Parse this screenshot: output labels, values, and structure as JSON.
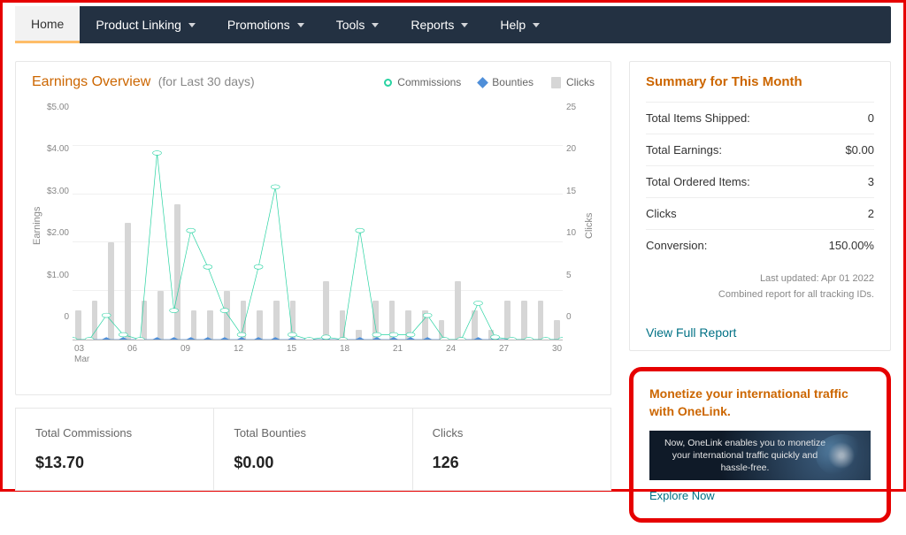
{
  "nav": {
    "items": [
      {
        "label": "Home",
        "active": true,
        "dropdown": false
      },
      {
        "label": "Product Linking",
        "active": false,
        "dropdown": true
      },
      {
        "label": "Promotions",
        "active": false,
        "dropdown": true
      },
      {
        "label": "Tools",
        "active": false,
        "dropdown": true
      },
      {
        "label": "Reports",
        "active": false,
        "dropdown": true
      },
      {
        "label": "Help",
        "active": false,
        "dropdown": true
      }
    ]
  },
  "chart": {
    "title": "Earnings Overview",
    "subtitle": "(for Last 30 days)",
    "legend": {
      "commissions": "Commissions",
      "bounties": "Bounties",
      "clicks": "Clicks"
    },
    "y_left_label": "Earnings",
    "y_right_label": "Clicks",
    "y_left_ticks": [
      "$5.00",
      "$4.00",
      "$3.00",
      "$2.00",
      "$1.00",
      "0"
    ],
    "y_right_ticks": [
      "25",
      "20",
      "15",
      "10",
      "5",
      "0"
    ],
    "x_ticks": [
      "03",
      "06",
      "09",
      "12",
      "15",
      "18",
      "21",
      "24",
      "27",
      "30"
    ],
    "x_month": "Mar"
  },
  "chart_data": {
    "type": "line+bar",
    "x": [
      "03",
      "04",
      "05",
      "06",
      "07",
      "08",
      "09",
      "10",
      "11",
      "12",
      "13",
      "14",
      "15",
      "16",
      "17",
      "18",
      "19",
      "20",
      "21",
      "22",
      "23",
      "24",
      "25",
      "26",
      "27",
      "28",
      "29",
      "30",
      "31",
      "01"
    ],
    "series": [
      {
        "name": "Commissions",
        "axis": "left",
        "style": "line",
        "color": "#29d3a2",
        "values": [
          0,
          0,
          0.5,
          0.1,
          0,
          3.85,
          0.6,
          2.25,
          1.5,
          0.6,
          0.1,
          1.5,
          3.15,
          0.1,
          0,
          0.05,
          0,
          2.25,
          0.1,
          0.1,
          0.1,
          0.5,
          0,
          0,
          0.75,
          0.05,
          0,
          0,
          0,
          0
        ]
      },
      {
        "name": "Bounties",
        "axis": "left",
        "style": "line",
        "color": "#4f8fd9",
        "values": [
          0,
          0,
          0,
          0,
          0,
          0,
          0,
          0,
          0,
          0,
          0,
          0,
          0,
          0,
          0,
          0,
          0,
          0,
          0,
          0,
          0,
          0,
          0,
          0,
          0,
          0,
          0,
          0,
          0,
          0
        ]
      },
      {
        "name": "Clicks",
        "axis": "right",
        "style": "bar",
        "color": "#d6d6d6",
        "values": [
          3,
          4,
          10,
          12,
          4,
          5,
          14,
          3,
          3,
          5,
          4,
          3,
          4,
          4,
          0,
          6,
          3,
          1,
          4,
          4,
          3,
          3,
          2,
          6,
          3,
          1,
          4,
          4,
          4,
          2
        ]
      }
    ],
    "ylim_left": [
      0,
      5
    ],
    "ylim_right": [
      0,
      25
    ],
    "xlabel": "",
    "ylabel_left": "Earnings",
    "ylabel_right": "Clicks"
  },
  "totals": {
    "commissions": {
      "label": "Total Commissions",
      "value": "$13.70"
    },
    "bounties": {
      "label": "Total Bounties",
      "value": "$0.00"
    },
    "clicks": {
      "label": "Clicks",
      "value": "126"
    }
  },
  "summary": {
    "title": "Summary for This Month",
    "rows": [
      {
        "label": "Total Items Shipped:",
        "value": "0"
      },
      {
        "label": "Total Earnings:",
        "value": "$0.00"
      },
      {
        "label": "Total Ordered Items:",
        "value": "3"
      },
      {
        "label": "Clicks",
        "value": "2"
      },
      {
        "label": "Conversion:",
        "value": "150.00%"
      }
    ],
    "last_updated": "Last updated: Apr 01 2022",
    "combined": "Combined report for all tracking IDs.",
    "view_full": "View Full Report"
  },
  "onelink": {
    "title": "Monetize your international traffic with OneLink.",
    "banner": "Now, OneLink enables you to monetize your international traffic quickly and hassle-free.",
    "explore": "Explore Now"
  }
}
